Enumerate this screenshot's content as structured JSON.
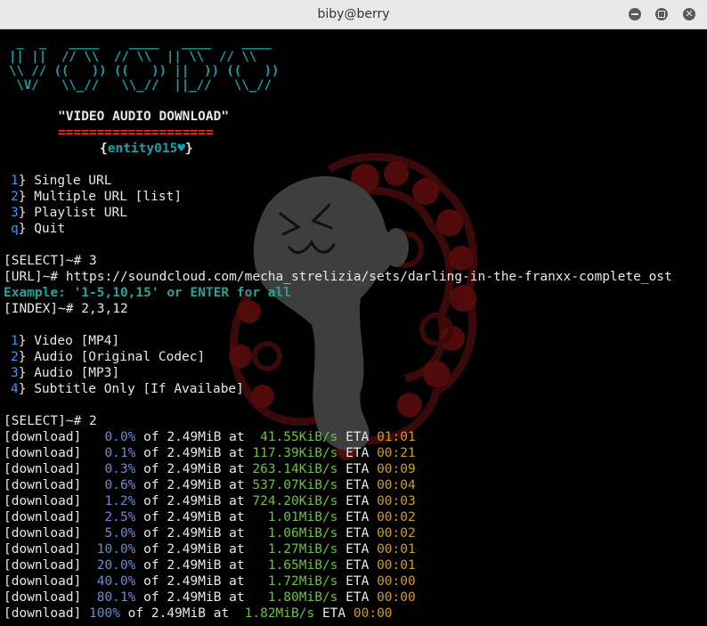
{
  "window": {
    "title": "biby@berry"
  },
  "banner": {
    "logo_ascii": " _  _   ____    ____   ____    ____\n|| ||  // \\\\  // \\\\  || \\\\  // \\\\\n\\\\ // ((   )) ((   )) ||  )) ((   ))\n \\V/   \\\\_//   \\\\_//  ||_//   \\\\_//",
    "subtitle": "\"VIDEO AUDIO DOWNLOAD\"",
    "underline": "====================",
    "author_open": "{",
    "author": "entity015♥",
    "author_close": "}"
  },
  "menu1": [
    {
      "key": "1",
      "label": "} Single URL"
    },
    {
      "key": "2",
      "label": "} Multiple URL [list]"
    },
    {
      "key": "3",
      "label": "} Playlist URL"
    },
    {
      "key": "q",
      "label": "} Quit"
    }
  ],
  "prompt1": "[SELECT]~# 3",
  "url_line": "[URL]~# https://soundcloud.com/mecha_strelizia/sets/darling-in-the-franxx-complete_ost",
  "example_line": "Example: '1-5,10,15' or ENTER for all",
  "index_line": "[INDEX]~# 2,3,12",
  "menu2": [
    {
      "key": "1",
      "label": "} Video [MP4]"
    },
    {
      "key": "2",
      "label": "} Audio [Original Codec]"
    },
    {
      "key": "3",
      "label": "} Audio [MP3]"
    },
    {
      "key": "4",
      "label": "} Subtitle Only [If Availabe]"
    }
  ],
  "prompt2": "[SELECT]~# 2",
  "downloads": [
    {
      "tag": "[download]",
      "pct": "0.0%",
      "size": "2.49MiB",
      "speed": "41.55KiB/s",
      "eta": "01:01"
    },
    {
      "tag": "[download]",
      "pct": "0.1%",
      "size": "2.49MiB",
      "speed": "117.39KiB/s",
      "eta": "00:21"
    },
    {
      "tag": "[download]",
      "pct": "0.3%",
      "size": "2.49MiB",
      "speed": "263.14KiB/s",
      "eta": "00:09"
    },
    {
      "tag": "[download]",
      "pct": "0.6%",
      "size": "2.49MiB",
      "speed": "537.07KiB/s",
      "eta": "00:04"
    },
    {
      "tag": "[download]",
      "pct": "1.2%",
      "size": "2.49MiB",
      "speed": "724.20KiB/s",
      "eta": "00:03"
    },
    {
      "tag": "[download]",
      "pct": "2.5%",
      "size": "2.49MiB",
      "speed": "1.01MiB/s",
      "eta": "00:02"
    },
    {
      "tag": "[download]",
      "pct": "5.0%",
      "size": "2.49MiB",
      "speed": "1.06MiB/s",
      "eta": "00:02"
    },
    {
      "tag": "[download]",
      "pct": "10.0%",
      "size": "2.49MiB",
      "speed": "1.27MiB/s",
      "eta": "00:01"
    },
    {
      "tag": "[download]",
      "pct": "20.0%",
      "size": "2.49MiB",
      "speed": "1.65MiB/s",
      "eta": "00:01"
    },
    {
      "tag": "[download]",
      "pct": "40.0%",
      "size": "2.49MiB",
      "speed": "1.72MiB/s",
      "eta": "00:00"
    },
    {
      "tag": "[download]",
      "pct": "80.1%",
      "size": "2.49MiB",
      "speed": "1.80MiB/s",
      "eta": "00:00"
    },
    {
      "tag": "[download]",
      "pct": "100%",
      "size": "2.49MiB",
      "speed": "1.82MiB/s",
      "eta": "00:00"
    }
  ],
  "words": {
    "of": "of",
    "at": "at",
    "eta": "ETA"
  },
  "colors": {
    "cyan": "#1aa0a8",
    "red": "#ff2a2a",
    "percent": "#6a8bd8",
    "speed": "#6ac23a",
    "eta_time": "#d29c1c",
    "menu_key": "#3f93ff"
  },
  "icons": [
    "minimize-icon",
    "maximize-icon",
    "close-icon",
    "ghost-mascot-icon"
  ]
}
